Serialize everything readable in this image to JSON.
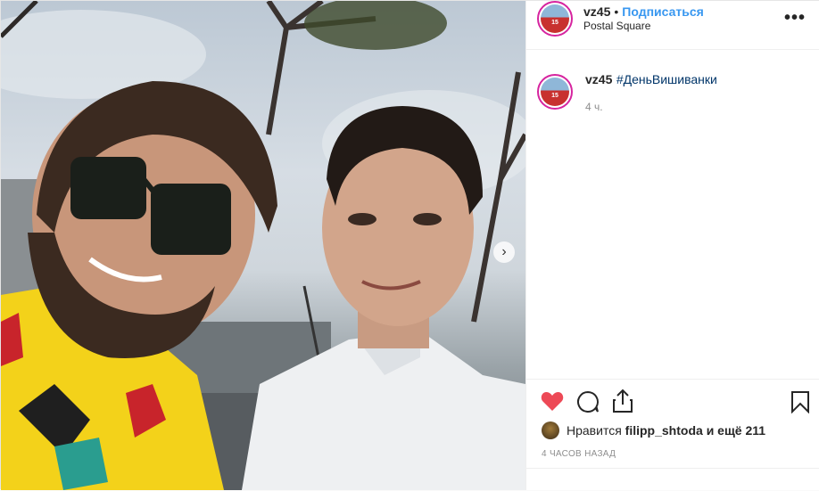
{
  "post": {
    "username": "vz45",
    "separator": "•",
    "follow_label": "Подписаться",
    "location": "Postal Square",
    "more_label": "•••",
    "caption_username": "vz45",
    "caption_hashtag": "#ДеньВишиванки",
    "caption_time": "4 ч.",
    "likes_prefix": "Нравится",
    "likes_user": "filipp_shtoda",
    "likes_suffix": "и ещё 211",
    "posted_ago": "4 ЧАСОВ НАЗАД",
    "next_label": "›"
  },
  "colors": {
    "like_red": "#ed4956",
    "follow_blue": "#3897f0",
    "hashtag_blue": "#003569"
  },
  "icons": {
    "like": "heart-icon",
    "comment": "comment-icon",
    "share": "share-icon",
    "save": "bookmark-icon",
    "next": "chevron-right-icon",
    "more": "more-options-icon"
  }
}
